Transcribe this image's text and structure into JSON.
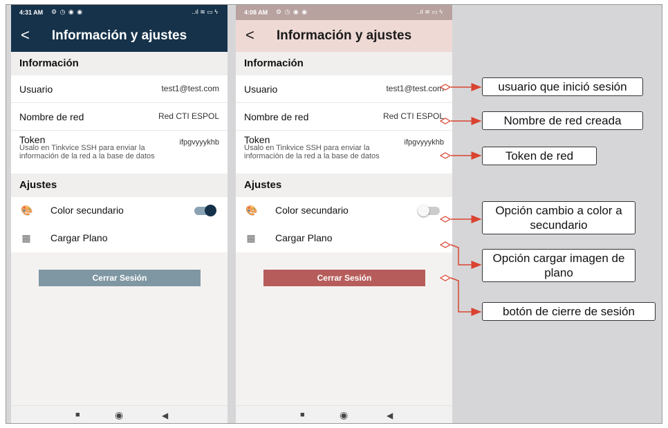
{
  "screens": [
    {
      "status": {
        "time": "4:31 AM",
        "icons": "⚙ ◷ ◉ ◉",
        "right": "..ıl ≋ ▭ ϟ"
      },
      "title": "Información y ajustes",
      "info_header": "Información",
      "user": {
        "label": "Usuario",
        "value": "test1@test.com"
      },
      "network": {
        "label": "Nombre de red",
        "value": "Red CTI ESPOL"
      },
      "token": {
        "label": "Token",
        "desc": "Úsalo en Tinkvice SSH para enviar la información de la red a la base de datos",
        "value": "ifpgvyyykhb"
      },
      "settings_header": "Ajustes",
      "color": {
        "label": "Color secundario",
        "on": true
      },
      "plan": {
        "label": "Cargar Plano"
      },
      "logout": "Cerrar Sesión",
      "colors": {
        "appbar": "#16324a",
        "logout": "#7f97a3"
      }
    },
    {
      "status": {
        "time": "4:08 AM",
        "icons": "⚙ ◷ ◉ ◉",
        "right": "..ıl ≋ ▭ ϟ"
      },
      "title": "Información y ajustes",
      "info_header": "Información",
      "user": {
        "label": "Usuario",
        "value": "test1@test.com"
      },
      "network": {
        "label": "Nombre de red",
        "value": "Red CTI ESPOL"
      },
      "token": {
        "label": "Token",
        "desc": "Úsalo en Tinkvice SSH para enviar la información de la red a la base de datos",
        "value": "ifpgvyyykhb"
      },
      "settings_header": "Ajustes",
      "color": {
        "label": "Color secundario",
        "on": false
      },
      "plan": {
        "label": "Cargar Plano"
      },
      "logout": "Cerrar Sesión",
      "colors": {
        "appbar": "#eed9d5",
        "logout": "#b65d5b"
      }
    }
  ],
  "annotations": [
    "usuario que inició sesión",
    "Nombre de red creada",
    "Token de red",
    "Opción cambio a color a secundario",
    "Opción cargar imagen de plano",
    "botón de cierre de sesión"
  ],
  "colors": {
    "arrow": "#d9432f",
    "label_border": "#333333"
  }
}
